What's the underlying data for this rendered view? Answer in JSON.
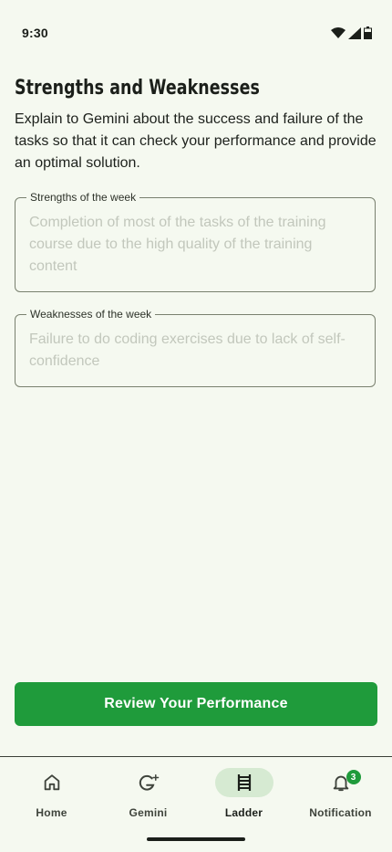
{
  "status_bar": {
    "time": "9:30"
  },
  "page": {
    "title": "Strengths and Weaknesses",
    "description": "Explain to Gemini about the success and failure of the tasks so that it can check your performance and provide an optimal solution."
  },
  "fields": {
    "strengths": {
      "label": "Strengths of the week",
      "placeholder": "Completion of most of the tasks of the training course due to the high quality of the training content"
    },
    "weaknesses": {
      "label": "Weaknesses of the week",
      "placeholder": "Failure to do coding exercises due to lack of self-confidence"
    }
  },
  "actions": {
    "review_label": "Review Your Performance"
  },
  "bottom_nav": {
    "items": [
      {
        "label": "Home",
        "icon": "home-icon"
      },
      {
        "label": "Gemini",
        "icon": "gemini-icon"
      },
      {
        "label": "Ladder",
        "icon": "ladder-icon",
        "active": true
      },
      {
        "label": "Notification",
        "icon": "bell-icon",
        "badge": "3"
      }
    ]
  },
  "colors": {
    "accent": "#1f9b3b",
    "background": "#f5f9f0",
    "active_pill": "#d6ead2"
  }
}
